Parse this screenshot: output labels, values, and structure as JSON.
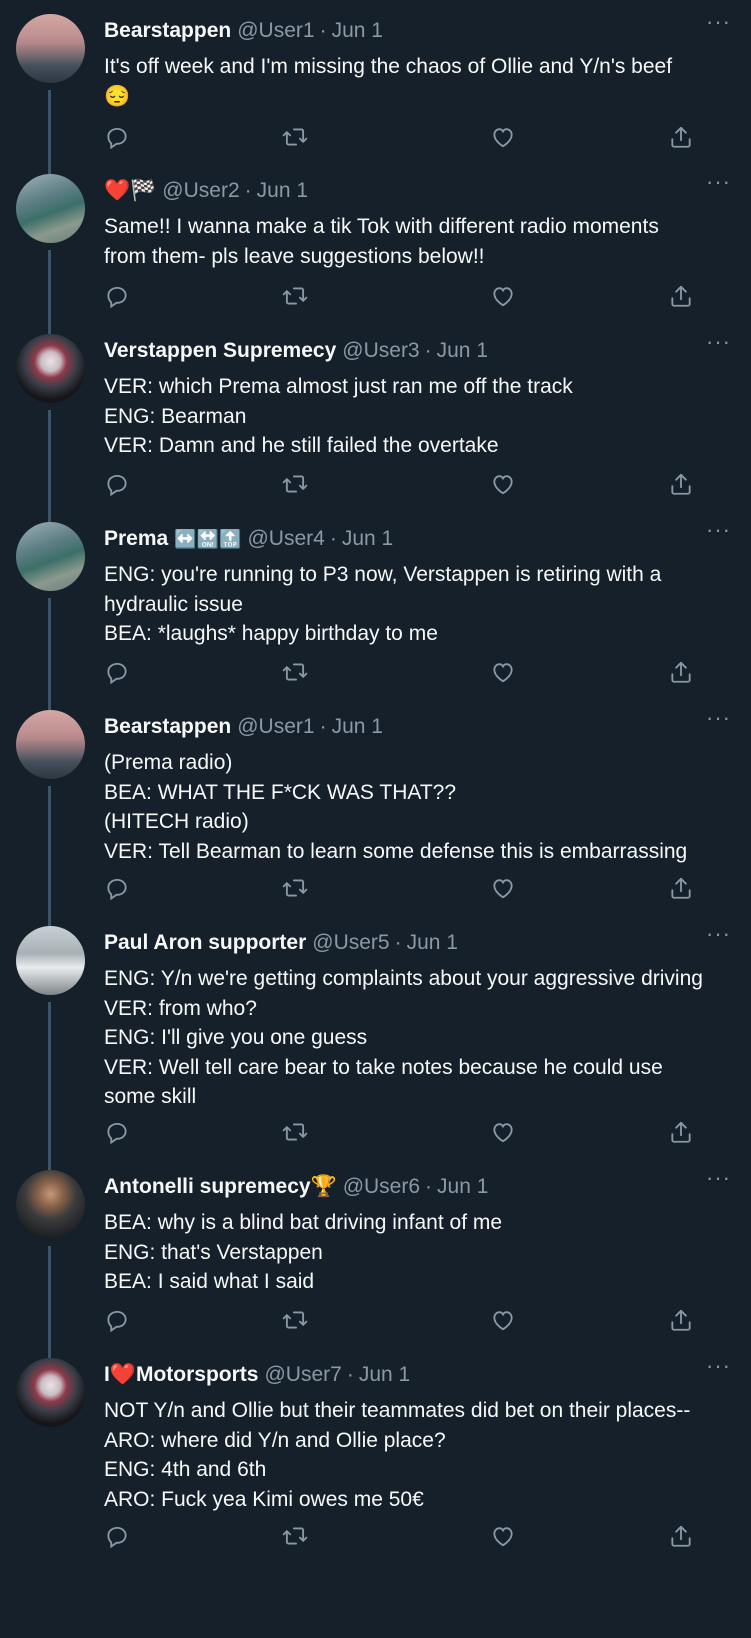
{
  "tweets": [
    {
      "name": "Bearstappen",
      "handle": "@User1",
      "date": "Jun 1",
      "lines": [
        "It's off week and I'm missing the chaos of Ollie and Y/n's beef",
        "😔"
      ],
      "avatar": "sunset-avatar"
    },
    {
      "name": "❤️🏁",
      "handle": "@User2",
      "date": "Jun 1",
      "lines": [
        "Same!! I wanna make a tik Tok with different radio moments",
        "from them- pls leave suggestions below!!"
      ],
      "avatar": "track-avatar"
    },
    {
      "name": "Verstappen Supremecy",
      "handle": "@User3",
      "date": "Jun 1",
      "lines": [
        "VER: which Prema almost just ran me off the track",
        "ENG: Bearman",
        "VER: Damn and he still failed the overtake"
      ],
      "avatar": "helmet-avatar"
    },
    {
      "name": "Prema",
      "name_suffix": "↔️🔛🔝",
      "handle": "@User4",
      "date": "Jun 1",
      "lines": [
        "ENG: you're running to P3 now, Verstappen is retiring with a",
        "hydraulic issue",
        "BEA: *laughs* happy birthday to me"
      ],
      "avatar": "track-avatar"
    },
    {
      "name": "Bearstappen",
      "handle": "@User1",
      "date": "Jun 1",
      "lines": [
        "(Prema radio)",
        "BEA: WHAT THE F*CK WAS THAT??",
        "(HITECH radio)",
        "VER: Tell Bearman to learn some defense this is embarrassing"
      ],
      "avatar": "sunset-avatar"
    },
    {
      "name": "Paul Aron supporter",
      "handle": "@User5",
      "date": "Jun 1",
      "lines": [
        "ENG: Y/n we're getting complaints about your aggressive driving",
        "VER: from who?",
        "ENG: I'll give you one guess",
        "VER: Well tell care bear to take notes because he could use",
        "some skill"
      ],
      "avatar": "team-avatar"
    },
    {
      "name": "Antonelli supremecy🏆",
      "handle": "@User6",
      "date": "Jun 1",
      "lines": [
        "BEA: why is a blind bat driving infant of me",
        "ENG: that's Verstappen",
        "BEA: I said what I said"
      ],
      "avatar": "driver-avatar"
    },
    {
      "name": "I❤️Motorsports",
      "handle": "@User7",
      "date": "Jun 1",
      "lines": [
        "NOT Y/n and Ollie but their teammates did bet on their places--",
        "ARO: where did Y/n and Ollie place?",
        "ENG: 4th and 6th",
        "ARO: Fuck yea Kimi owes me 50€"
      ],
      "avatar": "helmet-avatar"
    }
  ],
  "separator": "·",
  "more_glyph": "···",
  "colors": {
    "background": "#15202b",
    "text": "#f7f9f9",
    "secondary": "#8b98a5",
    "thread_line": "#3d5466"
  }
}
